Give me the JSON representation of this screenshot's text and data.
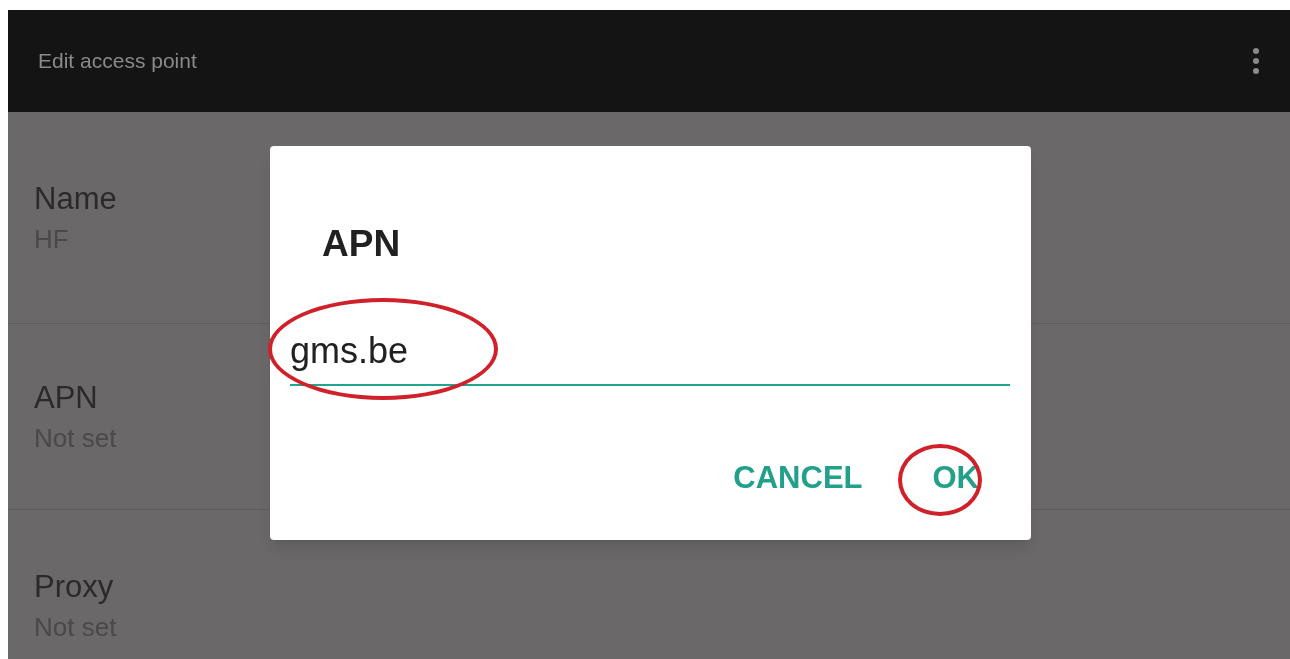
{
  "app_bar": {
    "title": "Edit access point"
  },
  "settings": [
    {
      "label": "Name",
      "value": "HF"
    },
    {
      "label": "APN",
      "value": "Not set"
    },
    {
      "label": "Proxy",
      "value": "Not set"
    }
  ],
  "dialog": {
    "title": "APN",
    "field_value": "gms.be",
    "buttons": [
      {
        "label": "CANCEL",
        "highlighted": false
      },
      {
        "label": "OK",
        "highlighted": true
      }
    ],
    "field_highlighted": true
  }
}
